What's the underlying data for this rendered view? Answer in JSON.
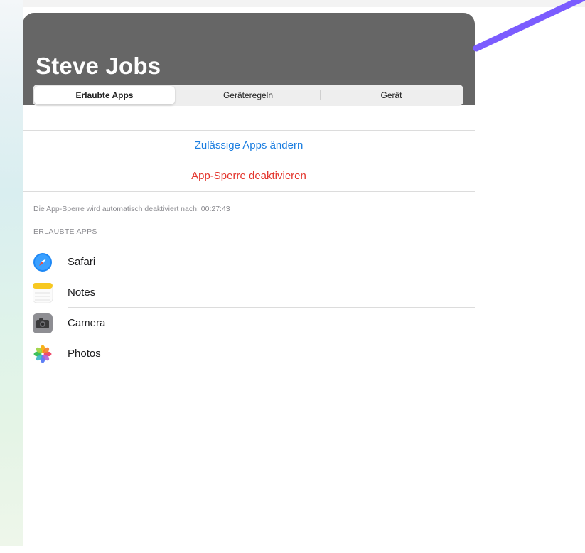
{
  "header": {
    "title": "Steve Jobs",
    "background_color": "#666666"
  },
  "tabs": [
    {
      "label": "Erlaubte Apps",
      "active": true
    },
    {
      "label": "Geräteregeln",
      "active": false
    },
    {
      "label": "Gerät",
      "active": false
    }
  ],
  "actions": {
    "edit_label": "Zulässige Apps ändern",
    "edit_color": "#1a7de0",
    "disable_label": "App-Sperre deaktivieren",
    "disable_color": "#e3342c"
  },
  "info_text": "Die App-Sperre wird automatisch deaktiviert nach: 00:27:43",
  "section_header": "ERLAUBTE APPS",
  "apps": [
    {
      "label": "Safari",
      "icon": "safari-icon"
    },
    {
      "label": "Notes",
      "icon": "notes-icon"
    },
    {
      "label": "Camera",
      "icon": "camera-icon"
    },
    {
      "label": "Photos",
      "icon": "photos-icon"
    }
  ],
  "arrow_color": "#7b5cff"
}
